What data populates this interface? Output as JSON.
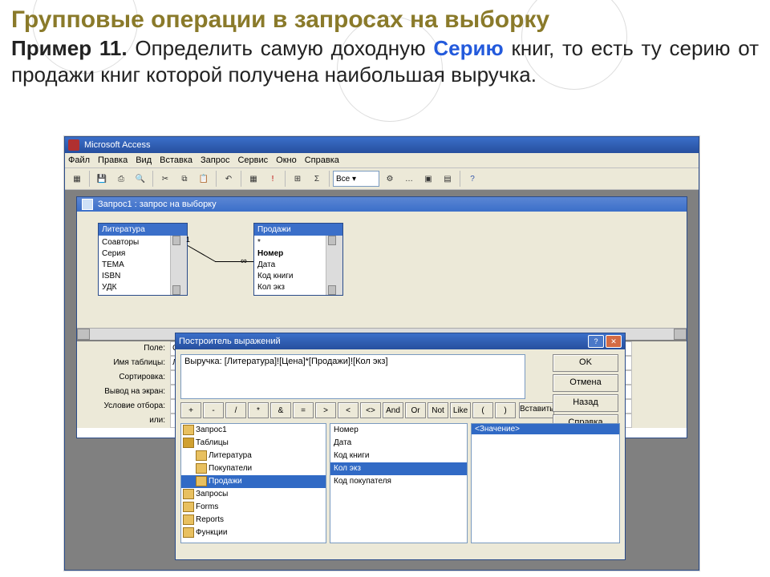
{
  "slide": {
    "title": "Групповые операции в запросах на выборку",
    "example_label": "Пример 11.",
    "subtitle_part1": " Определить самую доходную ",
    "subtitle_highlight": "Серию",
    "subtitle_part2": " книг, то есть ту серию от продажи книг которой получена наибольшая выручка."
  },
  "app": {
    "title": "Microsoft Access",
    "menu": [
      "Файл",
      "Правка",
      "Вид",
      "Вставка",
      "Запрос",
      "Сервис",
      "Окно",
      "Справка"
    ],
    "toolbar_combo": "Все"
  },
  "query_window": {
    "title": "Запрос1 : запрос на выборку",
    "table1": {
      "name": "Литература",
      "fields": [
        "Соавторы",
        "Серия",
        "ТЕМА",
        "ISBN",
        "УДК"
      ]
    },
    "table2": {
      "name": "Продажи",
      "fields": [
        "*",
        "Номер",
        "Дата",
        "Код книги",
        "Кол экз"
      ],
      "bold_field_index": 1
    },
    "relation_left": "1",
    "relation_right": "∞",
    "grid": {
      "labels": [
        "Поле:",
        "Имя таблицы:",
        "Сортировка:",
        "Вывод на экран:",
        "Условие отбора:",
        "или:"
      ],
      "col1": {
        "field": "Серия",
        "table": "Литература"
      },
      "col2": {
        "field": "Выручка:"
      }
    }
  },
  "expr_dialog": {
    "title": "Построитель выражений",
    "expression": "Выручка: [Литература]![Цена]*[Продажи]![Кол экз]",
    "buttons": {
      "ok": "OK",
      "cancel": "Отмена",
      "back": "Назад",
      "help": "Справка",
      "paste": "Вставить"
    },
    "operators": [
      "+",
      "-",
      "/",
      "*",
      "&",
      "=",
      ">",
      "<",
      "<>",
      "And",
      "Or",
      "Not",
      "Like",
      "(",
      ")"
    ],
    "tree": [
      {
        "label": "Запрос1",
        "type": "root"
      },
      {
        "label": "Таблицы",
        "type": "open"
      },
      {
        "label": "Литература",
        "type": "child"
      },
      {
        "label": "Покупатели",
        "type": "child"
      },
      {
        "label": "Продажи",
        "type": "child",
        "selected": true
      },
      {
        "label": "Запросы",
        "type": "root"
      },
      {
        "label": "Forms",
        "type": "root"
      },
      {
        "label": "Reports",
        "type": "root"
      },
      {
        "label": "Функции",
        "type": "root"
      }
    ],
    "mid_items": [
      "Номер",
      "Дата",
      "Код книги",
      "Кол экз",
      "Код покупателя"
    ],
    "mid_selected_index": 3,
    "right_header": "<Значение>"
  }
}
